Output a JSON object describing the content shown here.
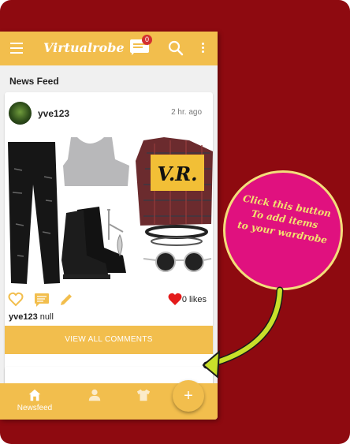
{
  "app": {
    "title": "Virtualrobe",
    "notification_count": "0"
  },
  "feed": {
    "section_title": "News Feed",
    "post": {
      "username": "yve123",
      "time": "2 hr. ago",
      "outfit_patch_text": "V.R.",
      "likes": "0 likes",
      "caption_user": "yve123",
      "caption_text": "null",
      "view_comments_label": "VIEW ALL COMMENTS"
    }
  },
  "bottom_nav": {
    "items": [
      {
        "label": "Newsfeed",
        "icon": "home-icon",
        "active": true
      },
      {
        "label": "",
        "icon": "person-icon"
      },
      {
        "label": "",
        "icon": "shirt-icon"
      },
      {
        "label": "",
        "icon": "wardrobe-icon"
      }
    ]
  },
  "fab": {
    "label": "+"
  },
  "callout": {
    "line1": "Click this button",
    "line2": "To add items",
    "line3": "to your wardrobe"
  },
  "colors": {
    "background": "#8e0a10",
    "accent": "#f2be4d",
    "callout": "#e0117f",
    "callout_text": "#f3e36f",
    "arrow": "#c8e02a",
    "like": "#e41b1b"
  }
}
